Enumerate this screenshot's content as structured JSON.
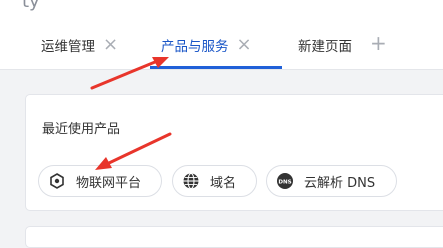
{
  "header": {
    "logo_fragment": "ty"
  },
  "tabs": [
    {
      "label": "运维管理",
      "active": false
    },
    {
      "label": "产品与服务",
      "active": true
    },
    {
      "label": "新建页面",
      "active": false
    }
  ],
  "recent": {
    "title": "最近使用产品",
    "items": [
      {
        "label": "物联网平台",
        "icon": "iot-hexagon-icon"
      },
      {
        "label": "域名",
        "icon": "globe-icon"
      },
      {
        "label": "云解析 DNS",
        "icon": "dns-icon"
      }
    ]
  },
  "annotations": {
    "arrow_color": "#e8352b"
  }
}
